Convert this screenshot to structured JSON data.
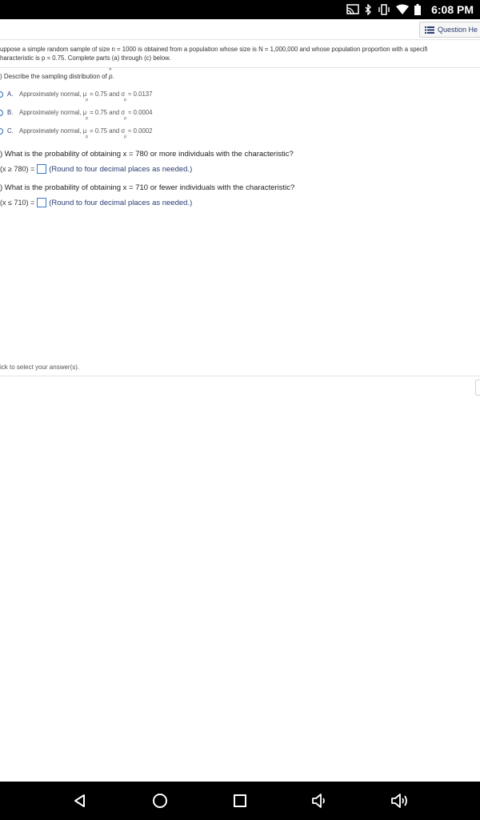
{
  "status_bar": {
    "time": "6:08 PM",
    "icons": [
      "cast-icon",
      "bluetooth-icon",
      "vibrate-icon",
      "wifi-icon",
      "battery-icon"
    ]
  },
  "header": {
    "question_help_label": "Question He"
  },
  "problem": {
    "line1": "uppose a simple random sample of size n = 1000 is obtained from a population whose size is N = 1,000,000 and whose population proportion with a specifi",
    "line2": "haracteristic is p = 0.75. Complete parts (a) through (c) below."
  },
  "part_a": {
    "title_prefix": ") Describe the sampling distribution of",
    "title_symbol": "p",
    "options": [
      {
        "letter": "A.",
        "text_pre": "Approximately normal, μ",
        "sub1": "p",
        "text_mid": " = 0.75 and σ",
        "sub2": "p",
        "text_post": " ≈ 0.0137"
      },
      {
        "letter": "B.",
        "text_pre": "Approximately normal, μ",
        "sub1": "p",
        "text_mid": " = 0.75 and σ",
        "sub2": "p",
        "text_post": " ≈ 0.0004"
      },
      {
        "letter": "C.",
        "text_pre": "Approximately normal, μ",
        "sub1": "p",
        "text_mid": " = 0.75 and σ",
        "sub2": "p",
        "text_post": " ≈ 0.0002"
      }
    ]
  },
  "part_b": {
    "question": ") What is the probability of obtaining x = 780 or more individuals with the characteristic?",
    "answer_label": "(x ≥ 780) =",
    "hint": "(Round to four decimal places as needed.)"
  },
  "part_c": {
    "question": ") What is the probability of obtaining x = 710 or fewer individuals with the characteristic?",
    "answer_label": "(x ≤ 710) =",
    "hint": "(Round to four decimal places as needed.)"
  },
  "footer": {
    "note": "ick to select your answer(s)."
  },
  "nav_bar": {
    "buttons": [
      "back-icon",
      "home-icon",
      "recents-icon",
      "volume-down-icon",
      "volume-up-icon"
    ]
  }
}
